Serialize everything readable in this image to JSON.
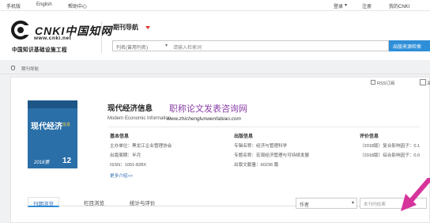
{
  "topbar": {
    "mobile": "手机版",
    "english": "English",
    "help": "帮助中心",
    "login": "登录",
    "login_caret": "▾",
    "register": "注册",
    "my_cnki": "我的CNKI"
  },
  "logo": {
    "main": "CNKI中国知网",
    "url": "www.cnki.net",
    "subtitle": "中国知识基础设施工程"
  },
  "nav": {
    "title": "期刊导航"
  },
  "search": {
    "field": "刊名(曾用刊名)",
    "placeholder": "请输入检索词",
    "button": "出版来源检索"
  },
  "breadcrumb": {
    "text": "期刊导航"
  },
  "actions": {
    "rss": "RSS订阅",
    "edge": "关"
  },
  "journal": {
    "cover_title": "现代经济",
    "cover_badge": "信息",
    "cover_issue": "2018第",
    "cover_number": "12",
    "title": "现代经济信息",
    "title_en": "Modern Economic Information"
  },
  "watermark": {
    "cn": "职称论文发表咨询网",
    "en": "www.zhichenglunwenfabiao.com"
  },
  "basic_info": {
    "heading": "基本信息",
    "lines": [
      "主办单位：黑龙江企业管理协会",
      "出版周期：半月",
      "ISSN：1001-828X"
    ],
    "more": "更多介绍>>"
  },
  "publish_info": {
    "heading": "出版信息",
    "lines": [
      "专辑名称：经济与管理科学",
      "专题名称：宏观经济管理与可持续发展",
      "出版文献量：60236 篇"
    ]
  },
  "evaluation_info": {
    "heading": "评价信息",
    "lines": [
      "（2018版）复合影响因子：0.1",
      "（2018版）综合影响因子：0.0"
    ]
  },
  "tabs": [
    {
      "label": "刊期浏览"
    },
    {
      "label": "栏目浏览"
    },
    {
      "label": "统计与评价"
    }
  ],
  "filter": {
    "author_select": "作者",
    "inner_search_placeholder": "本刊内检索"
  },
  "colors": {
    "accent_blue": "#2e8fd8",
    "nav_caret_red": "#e0342c",
    "watermark_purple": "#8a3fa8",
    "arrow_magenta": "#d6339b"
  }
}
